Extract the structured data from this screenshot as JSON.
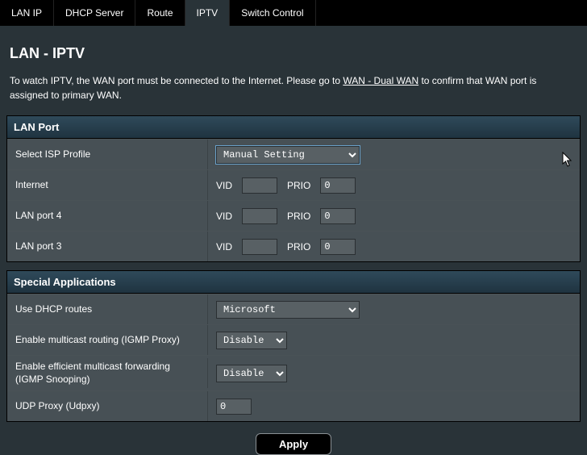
{
  "tabs": {
    "lan_ip": "LAN IP",
    "dhcp_server": "DHCP Server",
    "route": "Route",
    "iptv": "IPTV",
    "switch_control": "Switch Control",
    "active": "iptv"
  },
  "page": {
    "title": "LAN - IPTV",
    "desc_pre": "To watch IPTV, the WAN port must be connected to the Internet. Please go to ",
    "desc_link": "WAN - Dual WAN",
    "desc_post": " to confirm that WAN port is assigned to primary WAN."
  },
  "panels": {
    "lan_port": {
      "title": "LAN Port",
      "select_isp_label": "Select ISP Profile",
      "select_isp_value": "Manual Setting",
      "rows": [
        {
          "label": "Internet",
          "vid": "",
          "prio": "0"
        },
        {
          "label": "LAN port 4",
          "vid": "",
          "prio": "0"
        },
        {
          "label": "LAN port 3",
          "vid": "",
          "prio": "0"
        }
      ],
      "vid_label": "VID",
      "prio_label": "PRIO"
    },
    "special": {
      "title": "Special Applications",
      "dhcp_routes_label": "Use DHCP routes",
      "dhcp_routes_value": "Microsoft",
      "igmp_proxy_label": "Enable multicast routing (IGMP Proxy)",
      "igmp_proxy_value": "Disable",
      "igmp_snoop_label": "Enable efficient multicast forwarding (IGMP Snooping)",
      "igmp_snoop_value": "Disable",
      "udpxy_label": "UDP Proxy (Udpxy)",
      "udpxy_value": "0"
    }
  },
  "apply_label": "Apply"
}
